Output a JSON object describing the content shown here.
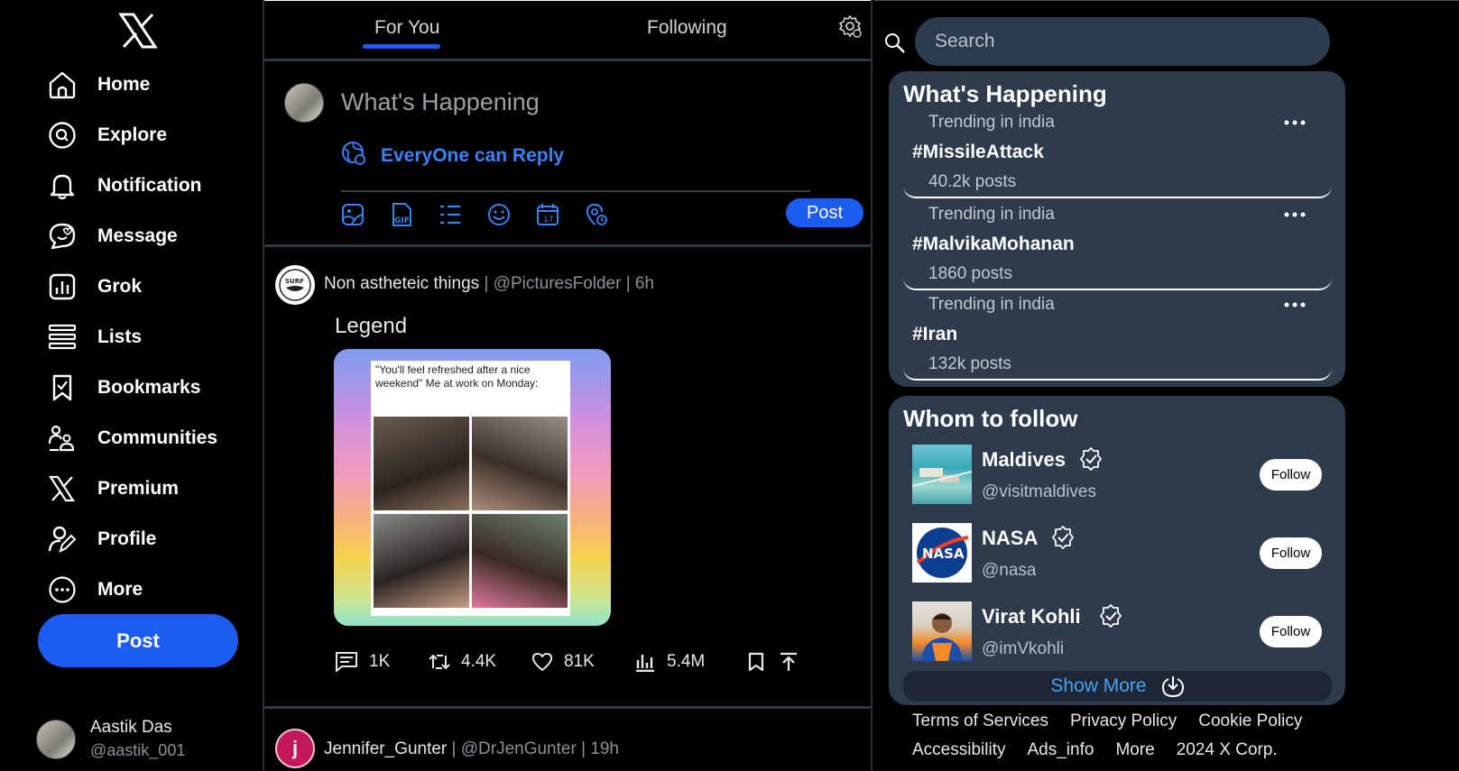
{
  "sidebar": {
    "logo": "X",
    "items": [
      {
        "label": "Home",
        "icon": "home-icon"
      },
      {
        "label": "Explore",
        "icon": "explore-icon"
      },
      {
        "label": "Notification",
        "icon": "bell-icon"
      },
      {
        "label": "Message",
        "icon": "message-icon"
      },
      {
        "label": "Grok",
        "icon": "grok-icon"
      },
      {
        "label": "Lists",
        "icon": "list-icon"
      },
      {
        "label": "Bookmarks",
        "icon": "bookmark-icon"
      },
      {
        "label": "Communities",
        "icon": "communities-icon"
      },
      {
        "label": "Premium",
        "icon": "x-premium-icon"
      },
      {
        "label": "Profile",
        "icon": "profile-icon"
      },
      {
        "label": "More",
        "icon": "more-circle-icon"
      }
    ],
    "post_label": "Post",
    "account": {
      "name": "Aastik Das",
      "handle": "@aastik_001"
    }
  },
  "feed": {
    "tabs": [
      {
        "label": "For You",
        "active": true
      },
      {
        "label": "Following",
        "active": false
      }
    ],
    "composer": {
      "placeholder": "What's Happening",
      "reply_setting": "EveryOne can Reply",
      "tools": [
        "image-icon",
        "gif-icon",
        "poll-icon",
        "emoji-icon",
        "schedule-icon",
        "location-icon"
      ],
      "post_label": "Post"
    },
    "tweets": [
      {
        "author": "Non astheteic things",
        "meta": " | @PicturesFolder | 6h",
        "text": "Legend",
        "media_caption": "\"You'll feel refreshed after a nice weekend\" Me at work on Monday:",
        "avatar_text": "SURF",
        "stats": {
          "replies": "1K",
          "retweets": "4.4K",
          "likes": "81K",
          "views": "5.4M"
        }
      },
      {
        "author": "Jennifer_Gunter",
        "meta": " | @DrJenGunter | 19h",
        "avatar_text": "j"
      }
    ]
  },
  "right": {
    "search_placeholder": "Search",
    "whats_happening": {
      "title": "What's Happening",
      "trends": [
        {
          "category": "Trending in india",
          "tag": "#MissileAttack",
          "count": "40.2k posts"
        },
        {
          "category": "Trending in india",
          "tag": "#MalvikaMohanan",
          "count": "1860 posts"
        },
        {
          "category": "Trending in india",
          "tag": "#Iran",
          "count": "132k posts"
        }
      ]
    },
    "who_to_follow": {
      "title": "Whom to follow",
      "accounts": [
        {
          "name": "Maldives",
          "handle": "@visitmaldives",
          "button": "Follow"
        },
        {
          "name": "NASA",
          "handle": "@nasa",
          "button": "Follow",
          "logo_text": "NASA"
        },
        {
          "name": "Virat Kohli",
          "handle": "@imVkohli",
          "button": "Follow"
        }
      ],
      "show_more": "Show More"
    },
    "footer": [
      "Terms of Services",
      "Privacy Policy",
      "Cookie Policy",
      "Accessibility",
      "Ads_info",
      "More",
      "2024 X Corp."
    ]
  },
  "colors": {
    "accent": "#1d5cf0",
    "link": "#3b82f6",
    "card": "#2e3b4d",
    "background": "#000000"
  }
}
